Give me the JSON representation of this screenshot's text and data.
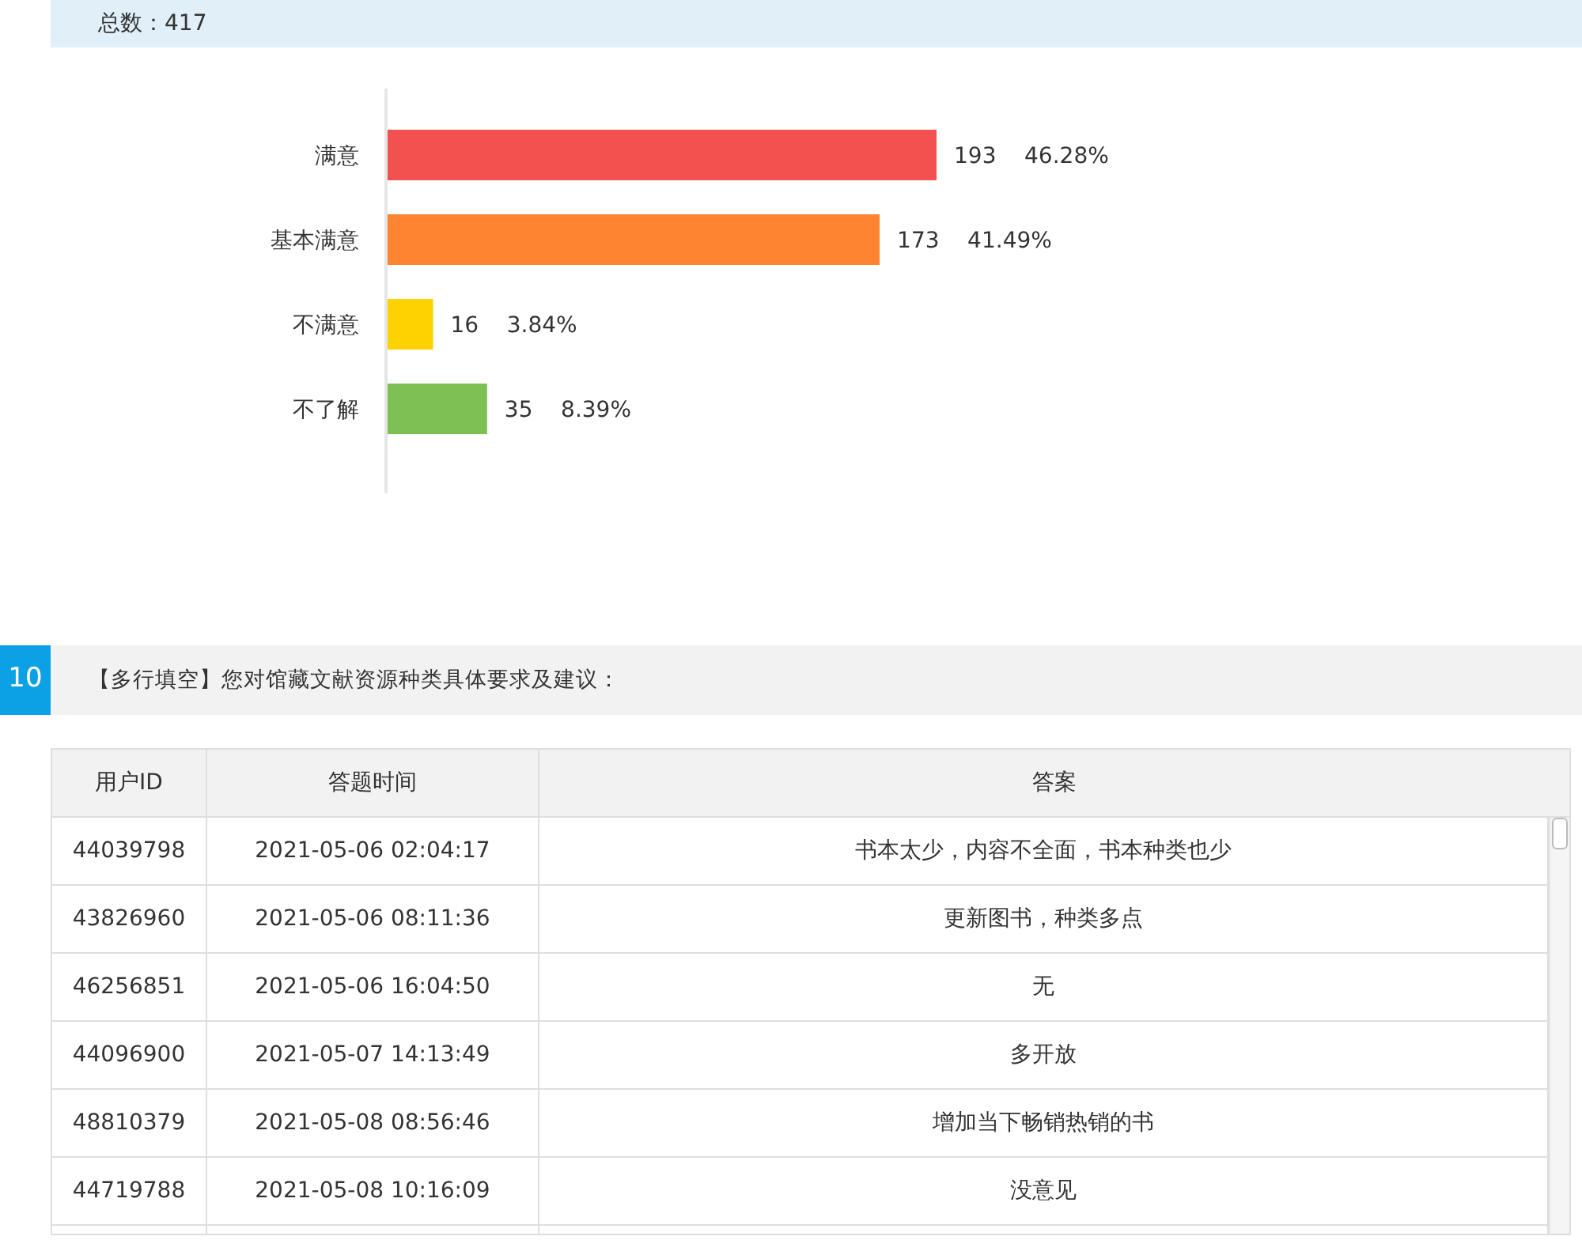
{
  "summary": {
    "total_label": "总数：417"
  },
  "chart": {
    "chart_data": {
      "type": "bar",
      "orientation": "horizontal",
      "categories": [
        "满意",
        "基本满意",
        "不满意",
        "不了解"
      ],
      "values": [
        193,
        173,
        16,
        35
      ],
      "colors": [
        "#f35050",
        "#fd8431",
        "#fed100",
        "#7fc054"
      ],
      "data_labels": true,
      "value_labels": [
        "193    46.28%",
        "173    41.49%",
        "16    3.84%",
        "35    8.39%"
      ]
    }
  },
  "question": {
    "number": "10",
    "text": "【多行填空】您对馆藏文献资源种类具体要求及建议："
  },
  "table": {
    "columns": [
      "用户ID",
      "答题时间",
      "答案"
    ],
    "rows": [
      [
        "44039798",
        "2021-05-06 02:04:17",
        "书本太少，内容不全面，书本种类也少"
      ],
      [
        "43826960",
        "2021-05-06 08:11:36",
        "更新图书，种类多点"
      ],
      [
        "46256851",
        "2021-05-06 16:04:50",
        "无"
      ],
      [
        "44096900",
        "2021-05-07 14:13:49",
        "多开放"
      ],
      [
        "48810379",
        "2021-05-08 08:56:46",
        "增加当下畅销热销的书"
      ],
      [
        "44719788",
        "2021-05-08 10:16:09",
        "没意见"
      ]
    ]
  }
}
